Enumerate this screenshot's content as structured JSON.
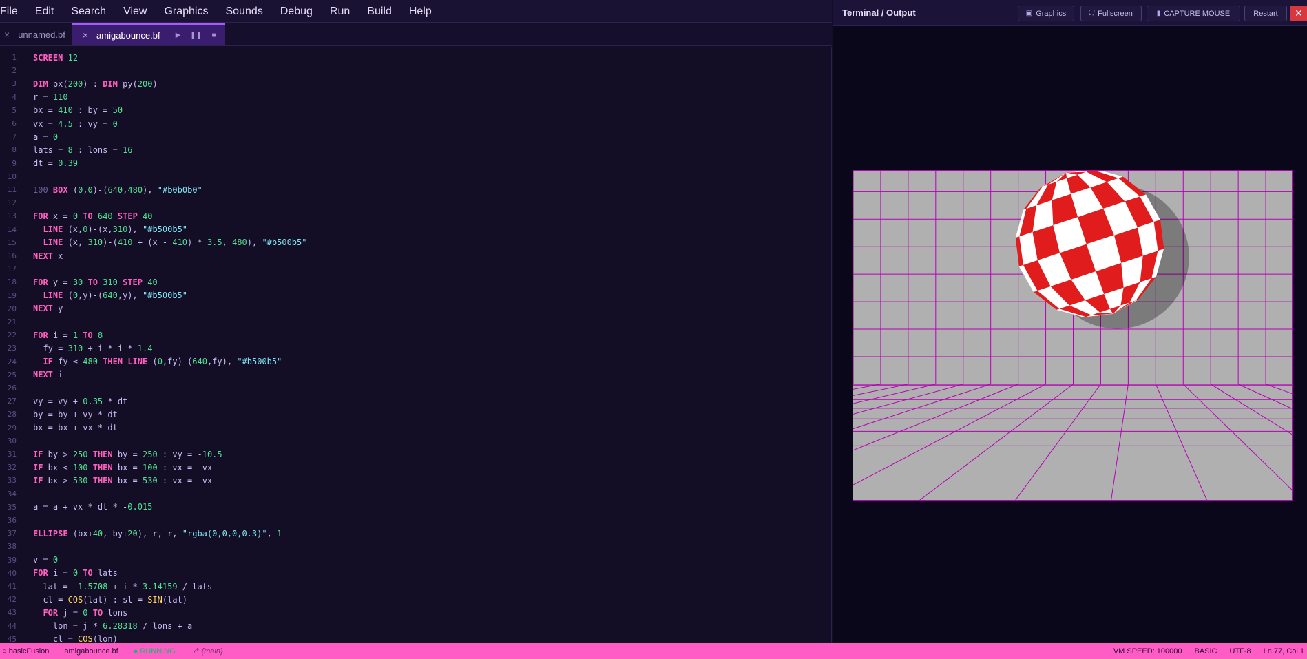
{
  "menu": [
    "File",
    "Edit",
    "Search",
    "View",
    "Graphics",
    "Sounds",
    "Debug",
    "Run",
    "Build",
    "Help"
  ],
  "tabs": [
    {
      "label": "unnamed.bf",
      "active": false
    },
    {
      "label": "amigabounce.bf",
      "active": true
    }
  ],
  "tab_controls": {
    "play_icon": "play-icon",
    "pause_icon": "pause-icon",
    "stop_icon": "stop-icon"
  },
  "panel": {
    "title": "Terminal / Output",
    "buttons": {
      "graphics": "Graphics",
      "fullscreen": "Fullscreen",
      "capture_mouse": "CAPTURE MOUSE",
      "restart": "Restart"
    }
  },
  "status": {
    "app": "basicFusion",
    "file": "amigabounce.bf",
    "state": "RUNNING",
    "branch": "{main}",
    "vm_speed": "VM SPEED: 100000",
    "language": "BASIC",
    "encoding": "UTF-8",
    "cursor": "Ln 77, Col 1"
  },
  "colors": {
    "accent": "#a55cff",
    "statusbar": "#ff5cc6",
    "grid": "#b500b5",
    "background": "#b0b0b0",
    "ball_red": "#e01c1c",
    "close_red": "#d9363e"
  },
  "code_lines": [
    "SCREEN 12",
    "",
    "DIM px(200) : DIM py(200)",
    "r = 110",
    "bx = 410 : by = 50",
    "vx = 4.5 : vy = 0",
    "a = 0",
    "lats = 8 : lons = 16",
    "dt = 0.39",
    "",
    "100 BOX (0,0)-(640,480), \"#b0b0b0\"",
    "",
    "FOR x = 0 TO 640 STEP 40",
    "  LINE (x,0)-(x,310), \"#b500b5\"",
    "  LINE (x, 310)-(410 + (x - 410) * 3.5, 480), \"#b500b5\"",
    "NEXT x",
    "",
    "FOR y = 30 TO 310 STEP 40",
    "  LINE (0,y)-(640,y), \"#b500b5\"",
    "NEXT y",
    "",
    "FOR i = 1 TO 8",
    "  fy = 310 + i * i * 1.4",
    "  IF fy ≤ 480 THEN LINE (0,fy)-(640,fy), \"#b500b5\"",
    "NEXT i",
    "",
    "vy = vy + 0.35 * dt",
    "by = by + vy * dt",
    "bx = bx + vx * dt",
    "",
    "IF by > 250 THEN by = 250 : vy = -10.5",
    "IF bx < 100 THEN bx = 100 : vx = -vx",
    "IF bx > 530 THEN bx = 530 : vx = -vx",
    "",
    "a = a + vx * dt * -0.015",
    "",
    "ELLIPSE (bx+40, by+20), r, r, \"rgba(0,0,0,0.3)\", 1",
    "",
    "v = 0",
    "FOR i = 0 TO lats",
    "  lat = -1.5708 + i * 3.14159 / lats",
    "  cl = COS(lat) : sl = SIN(lat)",
    "  FOR j = 0 TO lons",
    "    lon = j * 6.28318 / lons + a",
    "    cl = COS(lon)"
  ]
}
